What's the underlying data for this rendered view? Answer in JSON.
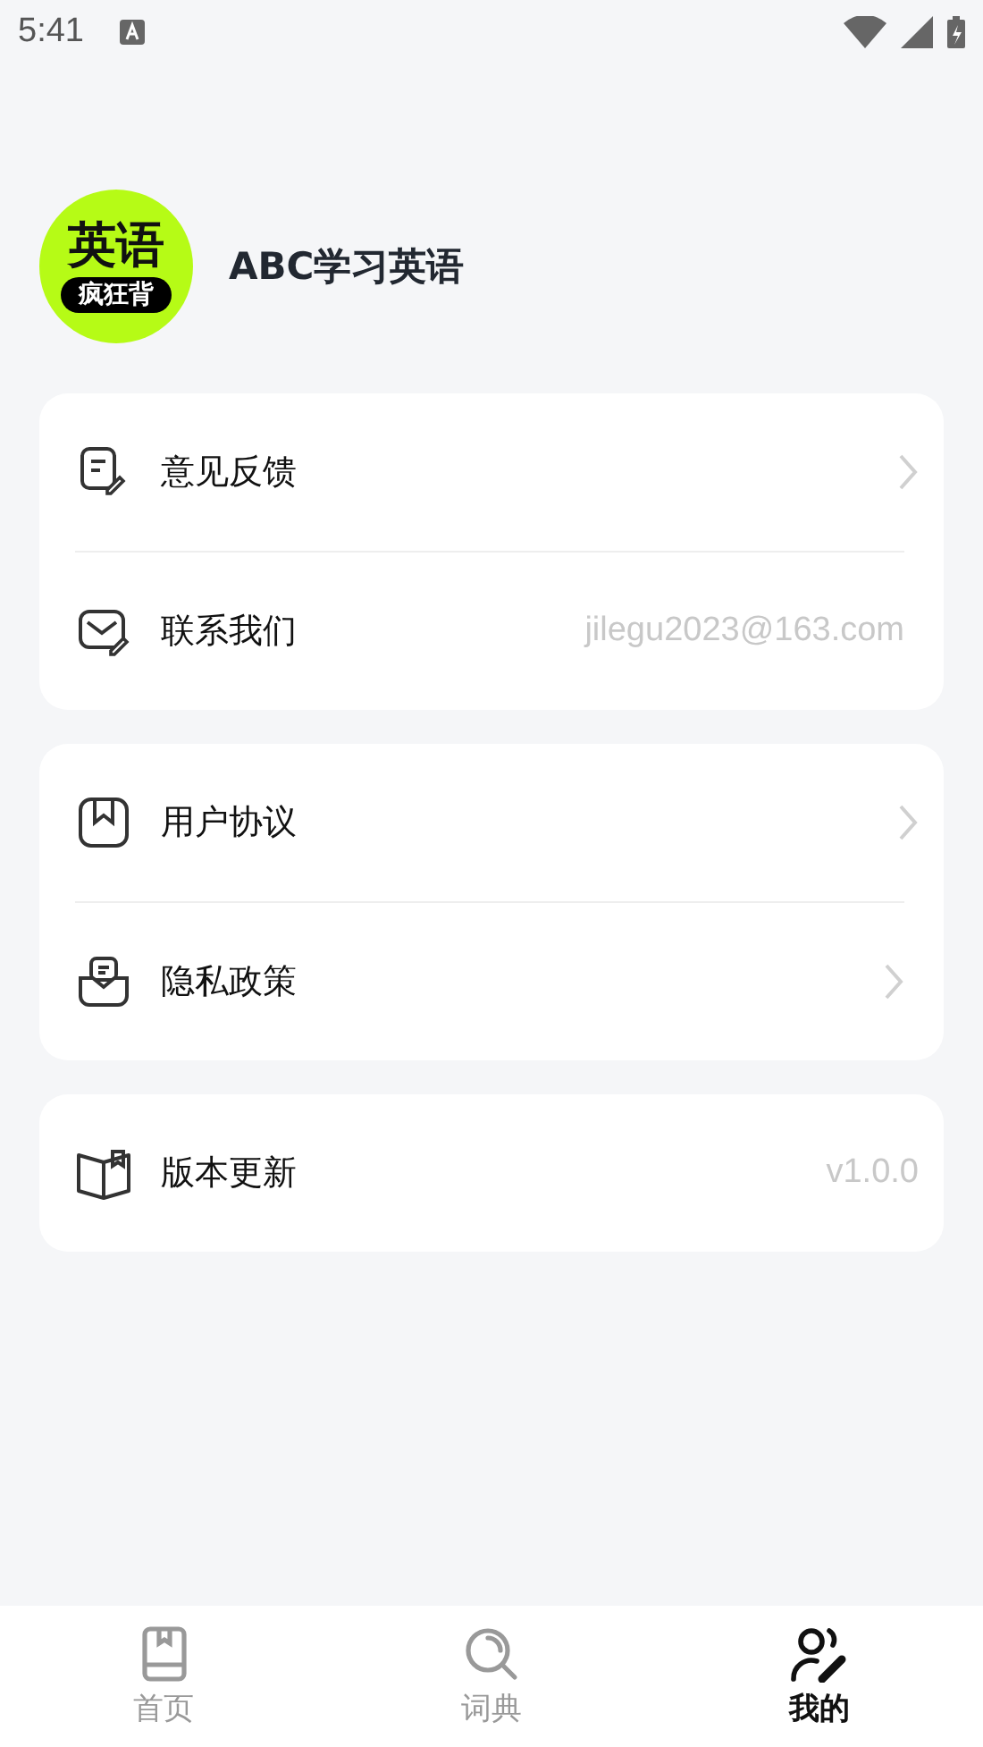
{
  "status_bar": {
    "time": "5:41"
  },
  "profile": {
    "logo_top": "英语",
    "logo_bottom": "疯狂背",
    "name": "ABC学习英语"
  },
  "groups": [
    {
      "items": [
        {
          "label": "意见反馈",
          "kind": "link"
        },
        {
          "label": "联系我们",
          "kind": "value",
          "value": "jilegu2023@163.com"
        }
      ]
    },
    {
      "items": [
        {
          "label": "用户协议",
          "kind": "link"
        },
        {
          "label": "隐私政策",
          "kind": "link"
        }
      ]
    },
    {
      "items": [
        {
          "label": "版本更新",
          "kind": "value",
          "value": "v1.0.0"
        }
      ]
    }
  ],
  "tabs": [
    {
      "label": "首页",
      "selected": false
    },
    {
      "label": "词典",
      "selected": false
    },
    {
      "label": "我的",
      "selected": true
    }
  ]
}
